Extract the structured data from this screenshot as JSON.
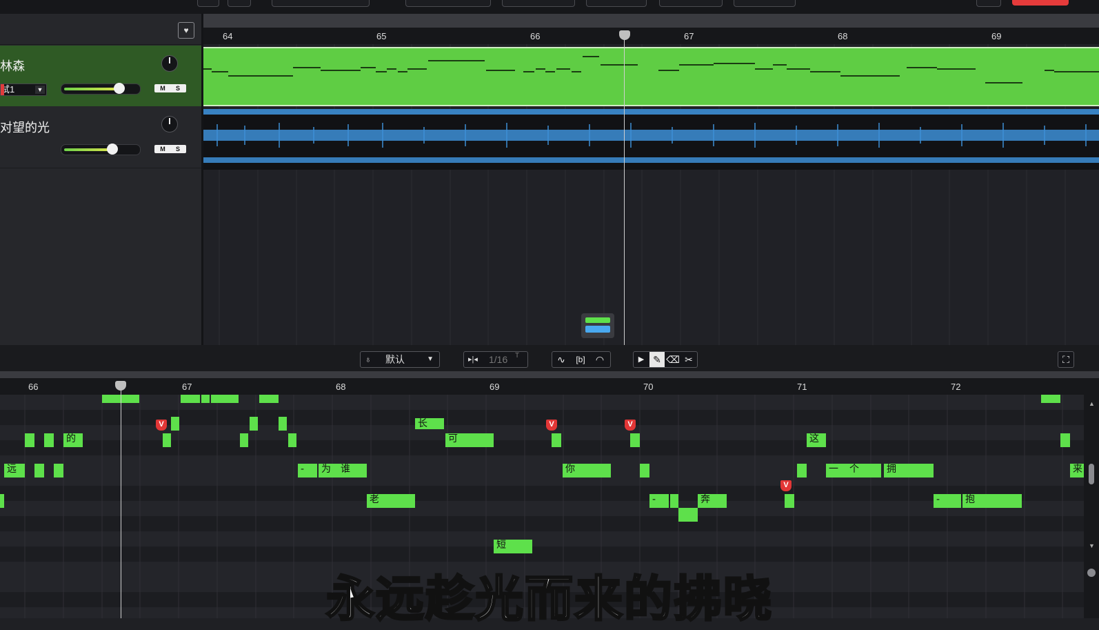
{
  "tracks": [
    {
      "name": "林森",
      "preset": "试1",
      "mute": "M",
      "solo": "S",
      "volume": 0.62
    },
    {
      "name": "对望的光",
      "mute": "M",
      "solo": "S",
      "volume": 0.55
    }
  ],
  "arrangement": {
    "ruler": [
      "64",
      "65",
      "66",
      "67",
      "68",
      "69"
    ]
  },
  "piano_roll_toolbar": {
    "voice_preset": "默认",
    "quantize": "1/16",
    "quantize_suffix": "T",
    "pitch_tool": "∿",
    "breath_tool": "[b]",
    "tempo_tool": "◠",
    "select_tool": "▶",
    "pen_tool": "✎",
    "eraser_tool": "⌫",
    "split_tool": "✂",
    "fit_icon": "⛶"
  },
  "piano_roll": {
    "ruler": [
      "66",
      "67",
      "68",
      "69",
      "70",
      "71",
      "72"
    ],
    "notes": [
      {
        "lyric": "远"
      },
      {
        "lyric": "的"
      },
      {
        "lyric": "长"
      },
      {
        "lyric": "可"
      },
      {
        "lyric": "-"
      },
      {
        "lyric": "为"
      },
      {
        "lyric": "谁"
      },
      {
        "lyric": "老"
      },
      {
        "lyric": "你"
      },
      {
        "lyric": "短"
      },
      {
        "lyric": "-"
      },
      {
        "lyric": "奔"
      },
      {
        "lyric": "这"
      },
      {
        "lyric": "一"
      },
      {
        "lyric": "个"
      },
      {
        "lyric": "拥"
      },
      {
        "lyric": "-"
      },
      {
        "lyric": "抱"
      },
      {
        "lyric": "来"
      }
    ],
    "breath_marker": "V"
  },
  "subtitle": "永远趁光而来的拂晓",
  "colors": {
    "note": "#5ee04b",
    "clip": "#5fcd44",
    "waveform": "#3d8fd6",
    "breath": "#e23636",
    "record": "#e53b3b"
  }
}
